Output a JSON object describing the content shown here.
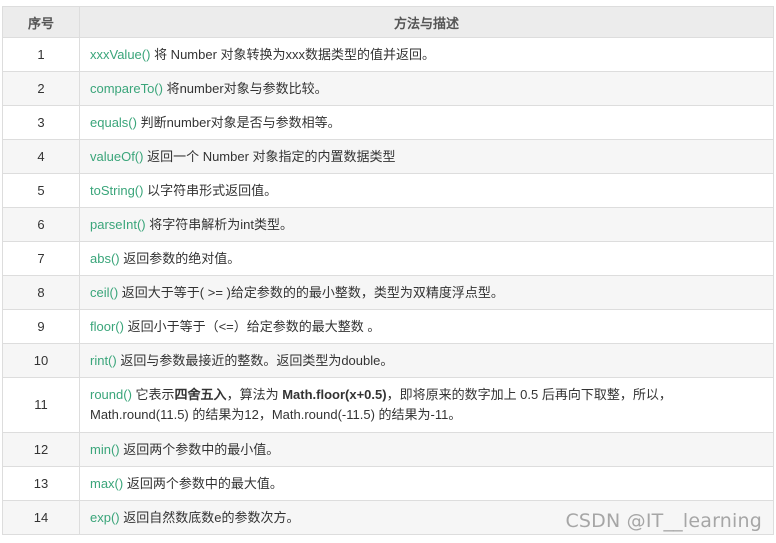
{
  "header": {
    "col_index": "序号",
    "col_method": "方法与描述"
  },
  "rows": [
    {
      "n": "1",
      "fn": "xxxValue()",
      "desc": " 将 Number 对象转换为xxx数据类型的值并返回。"
    },
    {
      "n": "2",
      "fn": "compareTo()",
      "desc": " 将number对象与参数比较。"
    },
    {
      "n": "3",
      "fn": "equals()",
      "desc": " 判断number对象是否与参数相等。"
    },
    {
      "n": "4",
      "fn": "valueOf()",
      "desc": " 返回一个 Number 对象指定的内置数据类型"
    },
    {
      "n": "5",
      "fn": "toString()",
      "desc": " 以字符串形式返回值。"
    },
    {
      "n": "6",
      "fn": "parseInt()",
      "desc": " 将字符串解析为int类型。"
    },
    {
      "n": "7",
      "fn": "abs()",
      "desc": " 返回参数的绝对值。"
    },
    {
      "n": "8",
      "fn": "ceil()",
      "desc": " 返回大于等于( >= )给定参数的的最小整数，类型为双精度浮点型。"
    },
    {
      "n": "9",
      "fn": "floor()",
      "desc": " 返回小于等于（<=）给定参数的最大整数 。"
    },
    {
      "n": "10",
      "fn": "rint()",
      "desc": " 返回与参数最接近的整数。返回类型为double。"
    },
    {
      "n": "11",
      "fn": "round()",
      "desc_a": " 它表示",
      "bold1": "四舍五入",
      "desc_b": "，算法为 ",
      "bold2": "Math.floor(x+0.5)",
      "desc_c": "，即将原来的数字加上 0.5 后再向下取整，所以，Math.round(11.5) 的结果为12，Math.round(-11.5) 的结果为-11。"
    },
    {
      "n": "12",
      "fn": "min()",
      "desc": " 返回两个参数中的最小值。"
    },
    {
      "n": "13",
      "fn": "max()",
      "desc": " 返回两个参数中的最大值。"
    },
    {
      "n": "14",
      "fn": "exp()",
      "desc": " 返回自然数底数e的参数次方。"
    }
  ],
  "watermark": "CSDN @IT__learning",
  "colors": {
    "link": "#3aa57a",
    "header_bg": "#ececec",
    "stripe": "#f6f6f6"
  }
}
